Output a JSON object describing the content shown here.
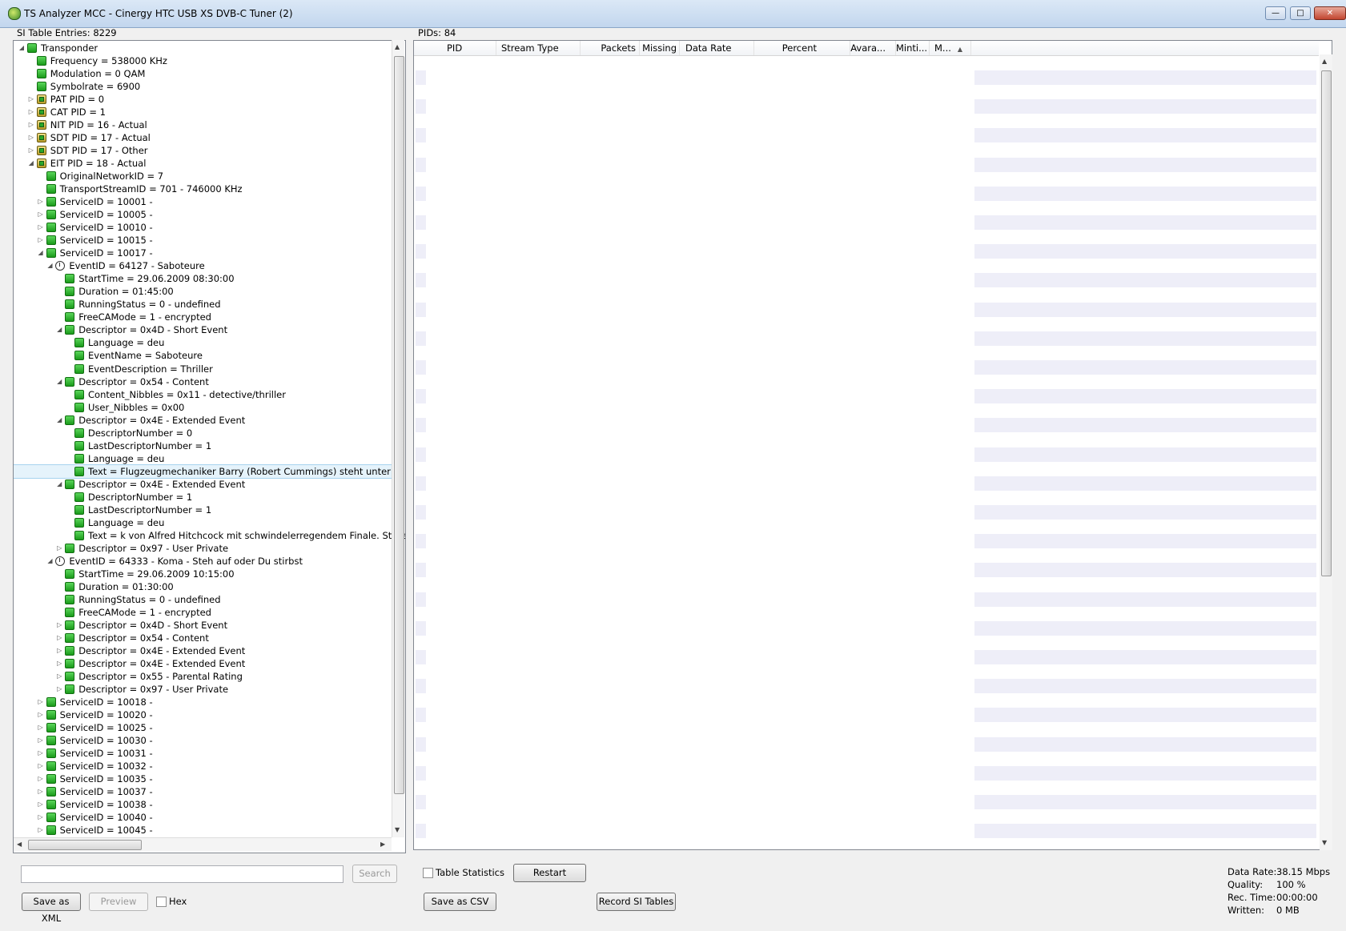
{
  "window": {
    "title": "TS Analyzer MCC - Cinergy HTC USB XS DVB-C Tuner (2)"
  },
  "left_panel": {
    "label": "SI Table Entries: 8229"
  },
  "right_panel": {
    "label": "PIDs: 84"
  },
  "tree": [
    {
      "text": "Transponder",
      "level": 0,
      "exp": "open",
      "icon": "green"
    },
    {
      "text": "Frequency = 538000 KHz",
      "level": 1,
      "exp": "",
      "icon": "green"
    },
    {
      "text": "Modulation = 0 QAM",
      "level": 1,
      "exp": "",
      "icon": "green"
    },
    {
      "text": "Symbolrate = 6900",
      "level": 1,
      "exp": "",
      "icon": "green"
    },
    {
      "text": "PAT PID = 0",
      "level": 1,
      "exp": "closed",
      "icon": "table"
    },
    {
      "text": "CAT PID = 1",
      "level": 1,
      "exp": "closed",
      "icon": "table"
    },
    {
      "text": "NIT PID = 16 - Actual",
      "level": 1,
      "exp": "closed",
      "icon": "table"
    },
    {
      "text": "SDT PID = 17 - Actual",
      "level": 1,
      "exp": "closed",
      "icon": "table"
    },
    {
      "text": "SDT PID = 17 - Other",
      "level": 1,
      "exp": "closed",
      "icon": "table"
    },
    {
      "text": "EIT PID = 18 - Actual",
      "level": 1,
      "exp": "open",
      "icon": "table"
    },
    {
      "text": "OriginalNetworkID = 7",
      "level": 2,
      "exp": "",
      "icon": "green"
    },
    {
      "text": "TransportStreamID = 701 - 746000 KHz",
      "level": 2,
      "exp": "",
      "icon": "green"
    },
    {
      "text": "ServiceID = 10001 -",
      "level": 2,
      "exp": "closed",
      "icon": "green"
    },
    {
      "text": "ServiceID = 10005 -",
      "level": 2,
      "exp": "closed",
      "icon": "green"
    },
    {
      "text": "ServiceID = 10010 -",
      "level": 2,
      "exp": "closed",
      "icon": "green"
    },
    {
      "text": "ServiceID = 10015 -",
      "level": 2,
      "exp": "closed",
      "icon": "green"
    },
    {
      "text": "ServiceID = 10017 -",
      "level": 2,
      "exp": "open",
      "icon": "green"
    },
    {
      "text": "EventID = 64127 - Saboteure",
      "level": 3,
      "exp": "open",
      "icon": "event"
    },
    {
      "text": "StartTime = 29.06.2009 08:30:00",
      "level": 4,
      "exp": "",
      "icon": "green"
    },
    {
      "text": "Duration = 01:45:00",
      "level": 4,
      "exp": "",
      "icon": "green"
    },
    {
      "text": "RunningStatus = 0 - undefined",
      "level": 4,
      "exp": "",
      "icon": "green"
    },
    {
      "text": "FreeCAMode = 1 - encrypted",
      "level": 4,
      "exp": "",
      "icon": "green"
    },
    {
      "text": "Descriptor = 0x4D - Short Event",
      "level": 4,
      "exp": "open",
      "icon": "green"
    },
    {
      "text": "Language = deu",
      "level": 5,
      "exp": "",
      "icon": "green"
    },
    {
      "text": "EventName = Saboteure",
      "level": 5,
      "exp": "",
      "icon": "green"
    },
    {
      "text": "EventDescription = Thriller",
      "level": 5,
      "exp": "",
      "icon": "green"
    },
    {
      "text": "Descriptor = 0x54 - Content",
      "level": 4,
      "exp": "open",
      "icon": "green"
    },
    {
      "text": "Content_Nibbles = 0x11 - detective/thriller",
      "level": 5,
      "exp": "",
      "icon": "green"
    },
    {
      "text": "User_Nibbles = 0x00",
      "level": 5,
      "exp": "",
      "icon": "green"
    },
    {
      "text": "Descriptor = 0x4E - Extended Event",
      "level": 4,
      "exp": "open",
      "icon": "green"
    },
    {
      "text": "DescriptorNumber = 0",
      "level": 5,
      "exp": "",
      "icon": "green"
    },
    {
      "text": "LastDescriptorNumber = 1",
      "level": 5,
      "exp": "",
      "icon": "green"
    },
    {
      "text": "Language = deu",
      "level": 5,
      "exp": "",
      "icon": "green"
    },
    {
      "text": "Text = Flugzeugmechaniker Barry (Robert Cummings) steht unter Sabo",
      "level": 5,
      "exp": "",
      "icon": "green",
      "selected": true
    },
    {
      "text": "Descriptor = 0x4E - Extended Event",
      "level": 4,
      "exp": "open",
      "icon": "green"
    },
    {
      "text": "DescriptorNumber = 1",
      "level": 5,
      "exp": "",
      "icon": "green"
    },
    {
      "text": "LastDescriptorNumber = 1",
      "level": 5,
      "exp": "",
      "icon": "green"
    },
    {
      "text": "Language = deu",
      "level": 5,
      "exp": "",
      "icon": "green"
    },
    {
      "text": "Text = k von Alfred Hitchcock mit schwindelerregendem Finale. Stereo",
      "level": 5,
      "exp": "",
      "icon": "green"
    },
    {
      "text": "Descriptor = 0x97 - User Private",
      "level": 4,
      "exp": "closed",
      "icon": "green"
    },
    {
      "text": "EventID = 64333 - Koma - Steh auf oder Du stirbst",
      "level": 3,
      "exp": "open",
      "icon": "event"
    },
    {
      "text": "StartTime = 29.06.2009 10:15:00",
      "level": 4,
      "exp": "",
      "icon": "green"
    },
    {
      "text": "Duration = 01:30:00",
      "level": 4,
      "exp": "",
      "icon": "green"
    },
    {
      "text": "RunningStatus = 0 - undefined",
      "level": 4,
      "exp": "",
      "icon": "green"
    },
    {
      "text": "FreeCAMode = 1 - encrypted",
      "level": 4,
      "exp": "",
      "icon": "green"
    },
    {
      "text": "Descriptor = 0x4D - Short Event",
      "level": 4,
      "exp": "closed",
      "icon": "green"
    },
    {
      "text": "Descriptor = 0x54 - Content",
      "level": 4,
      "exp": "closed",
      "icon": "green"
    },
    {
      "text": "Descriptor = 0x4E - Extended Event",
      "level": 4,
      "exp": "closed",
      "icon": "green"
    },
    {
      "text": "Descriptor = 0x4E - Extended Event",
      "level": 4,
      "exp": "closed",
      "icon": "green"
    },
    {
      "text": "Descriptor = 0x55 - Parental Rating",
      "level": 4,
      "exp": "closed",
      "icon": "green"
    },
    {
      "text": "Descriptor = 0x97 - User Private",
      "level": 4,
      "exp": "closed",
      "icon": "green"
    },
    {
      "text": "ServiceID = 10018 -",
      "level": 2,
      "exp": "closed",
      "icon": "green"
    },
    {
      "text": "ServiceID = 10020 -",
      "level": 2,
      "exp": "closed",
      "icon": "green"
    },
    {
      "text": "ServiceID = 10025 -",
      "level": 2,
      "exp": "closed",
      "icon": "green"
    },
    {
      "text": "ServiceID = 10030 -",
      "level": 2,
      "exp": "closed",
      "icon": "green"
    },
    {
      "text": "ServiceID = 10031 -",
      "level": 2,
      "exp": "closed",
      "icon": "green"
    },
    {
      "text": "ServiceID = 10032 -",
      "level": 2,
      "exp": "closed",
      "icon": "green"
    },
    {
      "text": "ServiceID = 10035 -",
      "level": 2,
      "exp": "closed",
      "icon": "green"
    },
    {
      "text": "ServiceID = 10037 -",
      "level": 2,
      "exp": "closed",
      "icon": "green"
    },
    {
      "text": "ServiceID = 10038 -",
      "level": 2,
      "exp": "closed",
      "icon": "green"
    },
    {
      "text": "ServiceID = 10040 -",
      "level": 2,
      "exp": "closed",
      "icon": "green"
    },
    {
      "text": "ServiceID = 10045 -",
      "level": 2,
      "exp": "closed",
      "icon": "green"
    }
  ],
  "columns": [
    "PID",
    "Stream Type",
    "Packets",
    "Missing",
    "Data Rate",
    "Percent",
    "Avara...",
    "Minti...",
    "M..."
  ],
  "controls": {
    "search_value": "",
    "search_button": "Search",
    "save_xml": "Save as XML",
    "preview": "Preview",
    "hex_label": "Hex",
    "table_statistics_label": "Table Statistics",
    "restart": "Restart",
    "save_csv": "Save as CSV",
    "record_si": "Record SI Tables"
  },
  "stats": {
    "data_rate_label": "Data Rate:",
    "data_rate_value": "38.15 Mbps",
    "quality_label": "Quality:",
    "quality_value": "100 %",
    "rec_time_label": "Rec. Time:",
    "rec_time_value": "00:00:00",
    "written_label": "Written:",
    "written_value": "0 MB"
  },
  "colors": {
    "node_green": "#1a9a1a",
    "selection": "#e5f3fb",
    "stripe": "#eeeef8"
  }
}
